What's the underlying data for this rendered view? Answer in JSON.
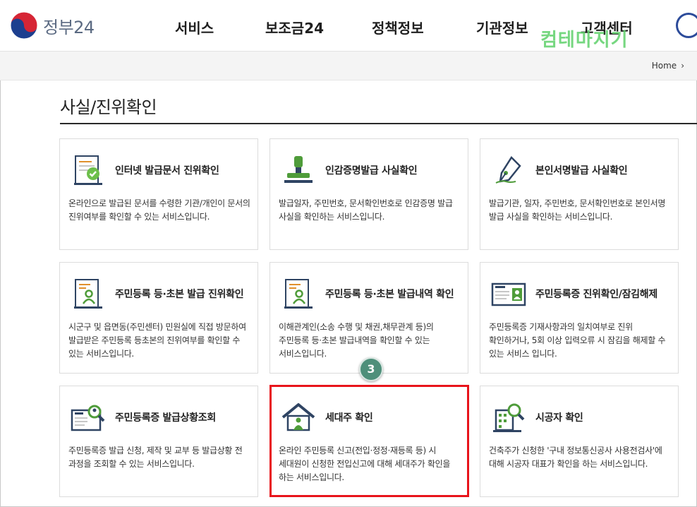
{
  "header": {
    "logo_text": "정부24",
    "nav": [
      "서비스",
      "보조금24",
      "정책정보",
      "기관정보",
      "고객센터"
    ],
    "watermark": "컴테마지기"
  },
  "breadcrumb": {
    "home": "Home",
    "arrow": "›"
  },
  "page_title": "사실/진위확인",
  "cards": [
    {
      "title": "인터넷 발급문서 진위확인",
      "desc": "온라인으로 발급된 문서를 수령한 기관/개인이 문서의 진위여부를 확인할 수 있는 서비스입니다.",
      "icon": "document-check-icon"
    },
    {
      "title": "인감증명발급 사실확인",
      "desc": "발급일자, 주민번호, 문서확인번호로 인감증명 발급 사실을 확인하는 서비스입니다.",
      "icon": "seal-stamp-icon"
    },
    {
      "title": "본인서명발급 사실확인",
      "desc": "발급기관, 일자, 주민번호, 문서확인번호로 본인서명 발급 사실을 확인하는 서비스입니다.",
      "icon": "pen-nib-icon"
    },
    {
      "title": "주민등록 등·초본 발급 진위확인",
      "desc": "시군구 및 읍면동(주민센터) 민원실에 직접 방문하여 발급받은 주민등록 등초본의 진위여부를 확인할 수 있는 서비스입니다.",
      "icon": "resident-document-icon"
    },
    {
      "title": "주민등록 등·초본 발급내역 확인",
      "desc": "이해관계인(소송 수행 및 채권,채무관계 등)의 주민등록 등·초본 발급내역을 확인할 수 있는 서비스입니다.",
      "icon": "resident-history-icon"
    },
    {
      "title": "주민등록증 진위확인/잠김해제",
      "desc": "주민등록증 기재사항과의 일치여부로 진위 확인하거나, 5회 이상 입력오류 시 잠김을 해제할 수 있는 서비스 입니다.",
      "icon": "id-card-icon"
    },
    {
      "title": "주민등록증 발급상황조회",
      "desc": "주민등록증 발급 신청, 제작 및 교부 등 발급상황 전 과정을 조회할 수 있는 서비스입니다.",
      "icon": "id-card-search-icon"
    },
    {
      "title": "세대주 확인",
      "desc": "온라인 주민등록 신고(전입·정정·재등록 등) 시 세대원이 신청한 전입신고에 대해 세대주가 확인을 하는 서비스입니다.",
      "icon": "house-person-icon"
    },
    {
      "title": "시공자 확인",
      "desc": "건축주가 신청한 '구내 정보통신공사 사용전검사'에 대해 시공자 대표가 확인을 하는 서비스입니다.",
      "icon": "building-search-icon"
    }
  ],
  "step_badge": "3",
  "colors": {
    "accent_green": "#2e8b57",
    "highlight_red": "#e8141b",
    "badge_teal": "#4e8f7a",
    "icon_navy": "#2f4463"
  }
}
